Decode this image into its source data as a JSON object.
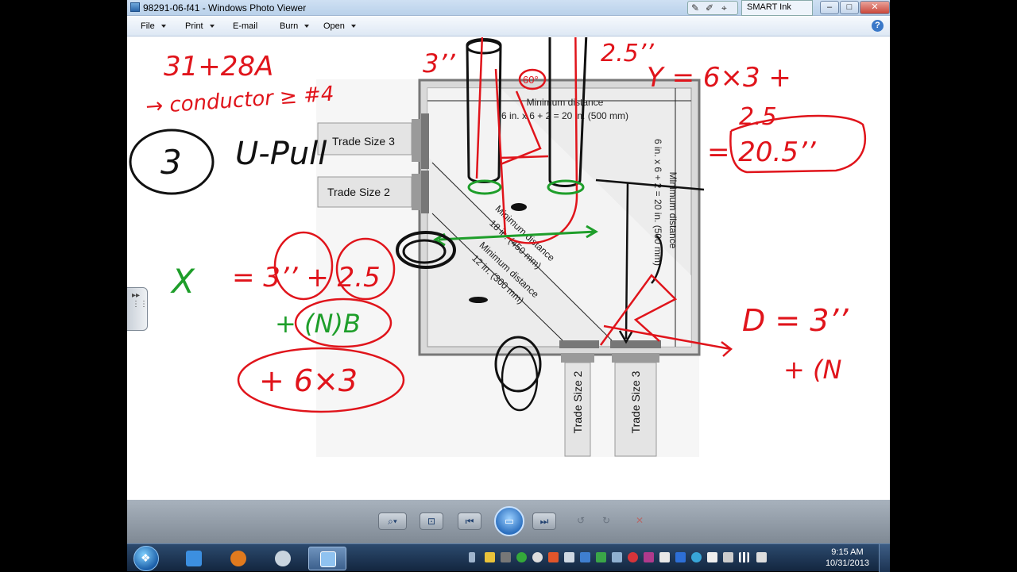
{
  "window": {
    "title": "98291-06-f41 - Windows Photo Viewer",
    "smart_ink_label": "SMART Ink",
    "minimize_label": "–",
    "maximize_label": "□",
    "close_label": "✕"
  },
  "menu": {
    "items": [
      {
        "label": "File"
      },
      {
        "label": "Print"
      },
      {
        "label": "E-mail"
      },
      {
        "label": "Burn"
      },
      {
        "label": "Open"
      }
    ],
    "help_label": "?"
  },
  "figure": {
    "labels": {
      "trade_size_3_left": "Trade Size 3",
      "trade_size_2_left": "Trade Size 2",
      "trade_size_2_bottom": "Trade Size 2",
      "trade_size_3_bottom": "Trade Size 3",
      "top_distance_line1": "Minimum distance",
      "top_distance_line2": "6 in. x 6 + 2 = 20 in. (500 mm)",
      "right_distance_line1": "Minimum distance",
      "right_distance_line2": "6 in. x 6 + 2 = 20 in. (500 mm)",
      "diag1_line1": "Minimum distance",
      "diag1_line2": "18 in. (450 mm)",
      "diag2_line1": "Minimum distance",
      "diag2_line2": "12 in. (300 mm)"
    }
  },
  "annotations": {
    "a1": "31+28A",
    "a2": "→ conductor ≥ #4",
    "a3": "3’’",
    "a4": "2.5’’",
    "a5": "Y = 6×3 +",
    "a6": "2.5",
    "a7": "= 20.5’’",
    "a8": "3",
    "a9": "U-Pull",
    "a10": "X",
    "a11": "= 3’’ + 2.5",
    "a12": "+ (N)B",
    "a13": "+ 6×3",
    "a14": "D = 3’’",
    "a15": "+ (N",
    "a16": "60°"
  },
  "taskbar": {
    "clock_time": "9:15 AM",
    "clock_date": "10/31/2013"
  },
  "colors": {
    "ink_red": "#e0141b",
    "ink_green": "#1e9e2a",
    "ink_black": "#111111"
  },
  "icons": {
    "zoom": "magnifier-icon",
    "fit": "fit-window-icon",
    "prev": "previous-icon",
    "slideshow": "slideshow-icon",
    "next": "next-icon",
    "rotate_ccw": "rotate-left-icon",
    "rotate_cw": "rotate-right-icon",
    "delete": "delete-icon"
  }
}
